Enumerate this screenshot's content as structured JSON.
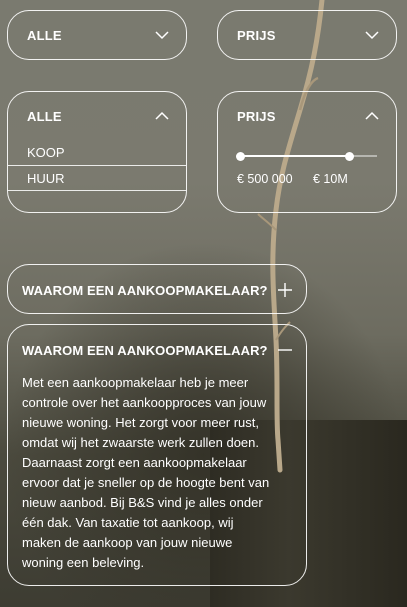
{
  "filters_collapsed": {
    "type_select": {
      "value": "ALLE",
      "icon": "chevron-down-icon"
    },
    "price_select": {
      "value": "PRIJS",
      "icon": "chevron-down-icon"
    }
  },
  "filters_expanded": {
    "type_select": {
      "value": "ALLE",
      "icon": "chevron-up-icon",
      "options": [
        "KOOP",
        "HUUR"
      ]
    },
    "price_select": {
      "value": "PRIJS",
      "icon": "chevron-up-icon",
      "slider": {
        "min_label": "€ 500 000",
        "max_label": "€ 10M",
        "fill_fraction": 0.8
      }
    }
  },
  "faq_collapsed": {
    "question": "WAAROM EEN AANKOOPMAKELAAR?",
    "icon": "plus-icon"
  },
  "faq_expanded": {
    "question": "WAAROM EEN AANKOOPMAKELAAR?",
    "icon": "minus-icon",
    "answer_lines": [
      "Met een aankoopmakelaar heb je meer",
      "controle over het aankoopproces van jouw",
      "nieuwe woning. Het zorgt voor meer rust,",
      "omdat wij het zwaarste werk zullen doen.",
      "Daarnaast zorgt een aankoopmakelaar",
      "ervoor dat je sneller op de hoogte bent van",
      "nieuw aanbod. Bij B&S vind je alles onder",
      "één dak. Van taxatie tot aankoop, wij",
      "maken de aankoop van jouw nieuwe",
      "woning een beleving."
    ]
  },
  "colors": {
    "text": "#ffffff",
    "border": "#ffffff",
    "background": "#6f6e62"
  }
}
